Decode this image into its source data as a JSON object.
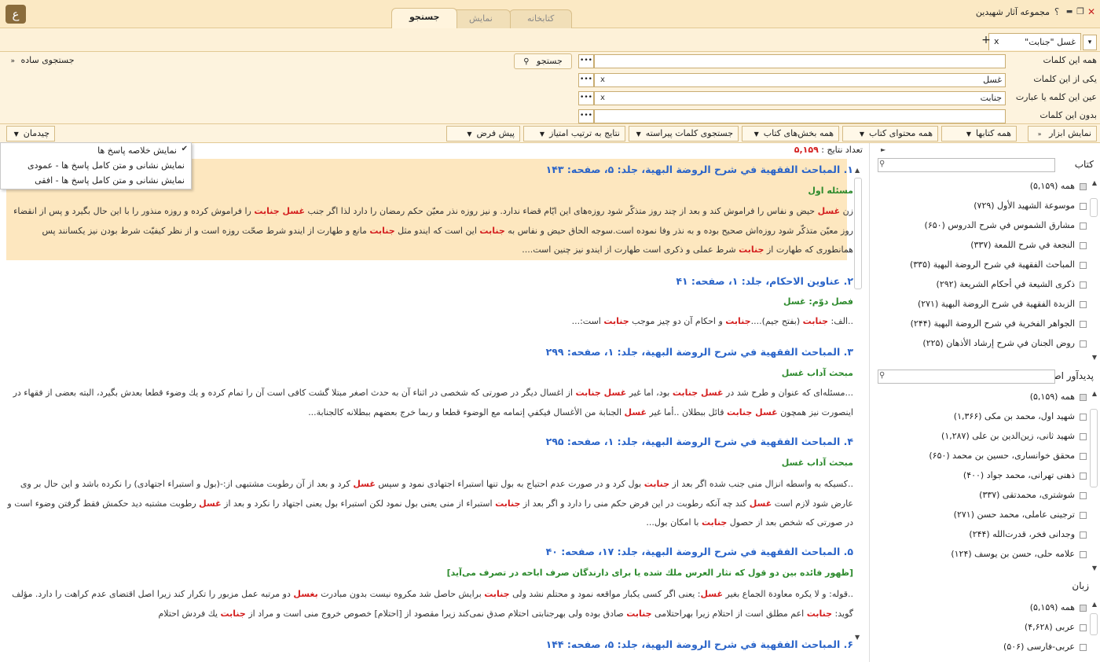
{
  "titlebar": {
    "logo_glyph": "ع",
    "app_title": "مجموعه آثار شهیدین",
    "tabs": [
      "کتابخانه",
      "نمایش",
      "جستجو"
    ],
    "active_tab": "جستجو",
    "buttons": {
      "close": "✕",
      "restore": "❐",
      "minimize": "▬",
      "help": "؟"
    }
  },
  "doc_tabs": {
    "tab_label": "غسل \"جنابت\"",
    "close": "x",
    "add": "+",
    "dropdown": "▾"
  },
  "search": {
    "all_words_label": "همه این کلمات",
    "any_words_label": "یکی از این کلمات",
    "exact_label": "عین این کلمه یا عبارت",
    "without_label": "بدون این کلمات",
    "all_words_value": "",
    "any_words_value": "غسل",
    "exact_value": "جنابت",
    "without_value": "",
    "search_button": "جستجو",
    "simple_search": "جستجوی ساده",
    "dots": "•••",
    "clear": "x"
  },
  "toolbar": {
    "show_tools": "نمایش ابزار",
    "all_books": "همه کتابها",
    "all_content": "همه محتوای کتاب",
    "all_sections": "همه بخش‌های کتاب",
    "sparse_search": "جستجوی کلمات پیراسته",
    "sort": "نتایج به ترتیب امتیاز",
    "default": "پیش فرض",
    "layout": "چیدمان"
  },
  "layout_menu": [
    "نمایش خلاصه پاسخ ها",
    "نمایش نشانی و متن کامل پاسخ ها - عمودی",
    "نمایش نشانی و متن کامل پاسخ ها - افقی"
  ],
  "results": {
    "count_label": "تعداد نتایج :",
    "count_value": "۵,۱۵۹",
    "items": [
      {
        "title": "۱. المباحث الفقهية في شرح الروضة البهية، جلد: ۵، صفحه: ۱۴۳",
        "subtitle": "مسئله اول"
      },
      {
        "title": "۲. عناوين الاحكام، جلد: ۱، صفحه: ۴۱",
        "subtitle": "فصل دوّم: غسل"
      },
      {
        "title": "۳. المباحث الفقهية في شرح الروضة البهية، جلد: ۱، صفحه: ۲۹۹",
        "subtitle": "مبحث آداب غسل"
      },
      {
        "title": "۴. المباحث الفقهية في شرح الروضة البهية، جلد: ۱، صفحه: ۲۹۵",
        "subtitle": "مبحث آداب غسل"
      },
      {
        "title": "۵. المباحث الفقهية في شرح الروضة البهية، جلد: ۱۷، صفحه: ۴۰",
        "subtitle": "[ظهور فائده بين دو قول كه نثار العرس ملك شده يا براى دارندگان صرف اباحه در تصرف مى‌آيد]"
      },
      {
        "title": "۶. المباحث الفقهية في شرح الروضة البهية، جلد: ۵، صفحه: ۱۴۴",
        "subtitle": ""
      }
    ]
  },
  "right_panel": {
    "books_label": "کتاب",
    "books": [
      "همه (۵,۱۵۹)",
      "موسوعة الشهيد الأول (۷۲۹)",
      "مشارق الشموس في شرح الدروس (۶۵۰)",
      "النجعة في شرح اللمعة (۳۳۷)",
      "المباحث الفقهية في شرح الروضة البهية (۳۳۵)",
      "ذكرى الشيعة في أحكام الشريعة (۲۹۲)",
      "الزبدة الفقهية في شرح الروضة البهية (۲۷۱)",
      "الجواهر الفخرية في شرح الروضة البهية (۲۴۴)",
      "روض الجنان في شرح إرشاد الأذهان (۲۲۵)"
    ],
    "authors_label": "پدیدآور اصلی",
    "authors": [
      "همه (۵,۱۵۹)",
      "شهید اول، محمد بن مکی (۱,۳۶۶)",
      "شهید ثانی، زین‌الدین بن علی (۱,۲۸۷)",
      "محقق خوانساری، حسین بن محمد (۶۵۰)",
      "ذهنی تهرانی، محمد جواد (۴۰۰)",
      "شوشتری، محمدتقی (۳۳۷)",
      "ترجینی عاملی، محمد حسن (۲۷۱)",
      "وجدانی فخر، قدرت‌الله (۲۴۴)",
      "علامه حلی، حسن بن یوسف (۱۲۴)"
    ],
    "language_label": "زبان",
    "languages": [
      "همه (۵,۱۵۹)",
      "عربی (۴,۶۲۸)",
      "عربی-فارسی (۵۰۶)"
    ]
  }
}
